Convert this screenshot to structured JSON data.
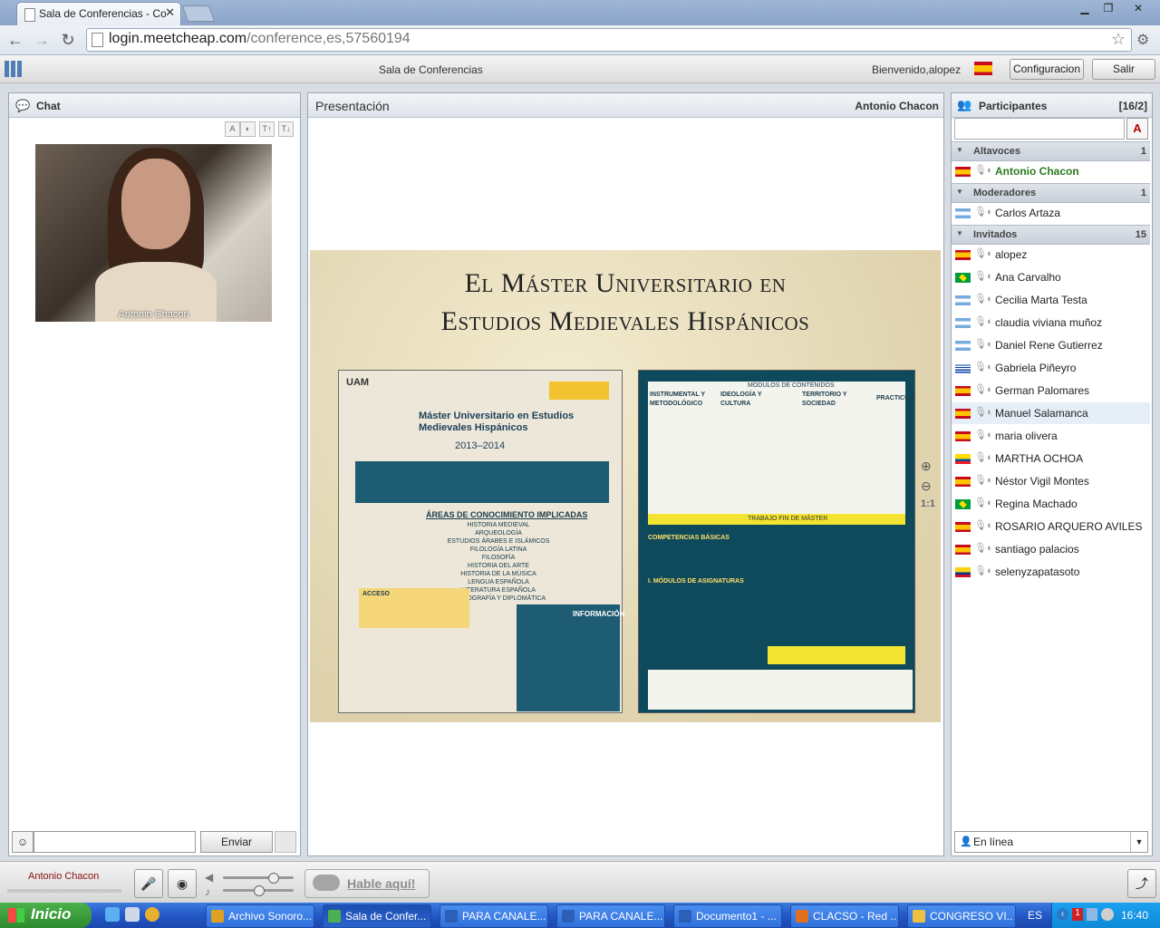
{
  "browser": {
    "tab_title": "Sala de Conferencias - Confe",
    "url_host": "login.meetcheap.com",
    "url_path": "/conference,es,57560194"
  },
  "app": {
    "room_title": "Sala de Conferencias",
    "welcome": "Bienvenido,alopez",
    "config_label": "Configuracion",
    "exit_label": "Salir"
  },
  "chat": {
    "title": "Chat",
    "video_caption": "Antonio Chacon",
    "send_label": "Enviar",
    "input_value": ""
  },
  "presentation": {
    "title": "Presentación",
    "presenter": "Antonio Chacon",
    "zoom_label": "1:1",
    "slide_title_line1": "El Máster Universitario en",
    "slide_title_line2": "Estudios Medievales Hispánicos",
    "left_page": {
      "univ": "UAM",
      "heading1": "Máster Universitario en Estudios",
      "heading2": "Medievales Hispánicos",
      "years": "2013–2014",
      "areas_title": "ÁREAS DE CONOCIMIENTO IMPLICADAS",
      "areas": [
        "HISTORIA MEDIEVAL",
        "ARQUEOLOGÍA",
        "ESTUDIOS ÁRABES E ISLÁMICOS",
        "FILOLOGÍA LATINA",
        "FILOSOFÍA",
        "HISTORIA DEL ARTE",
        "HISTORIA DE LA MÚSICA",
        "LENGUA ESPAÑOLA",
        "LITERATURA ESPAÑOLA",
        "PALEOGRAFÍA Y DIPLOMÁTICA"
      ],
      "info_title": "INFORMACIÓN",
      "acceso": "ACCESO"
    },
    "right_page": {
      "modules_title": "MÓDULOS DE CONTENIDOS",
      "col1": "INSTRUMENTAL Y METODOLÓGICO",
      "col2": "IDEOLOGÍA Y CULTURA",
      "col3": "TERRITORIO Y SOCIEDAD",
      "col4": "PRACTICUM",
      "tfm": "TRABAJO FIN DE MÁSTER",
      "competencias": "COMPETENCIAS BÁSICAS",
      "modulos": "I. MÓDULOS DE ASIGNATURAS"
    }
  },
  "participants": {
    "title": "Participantes",
    "count": "[16/2]",
    "sort_label": "A",
    "groups": [
      {
        "label": "Altavoces",
        "count": "1",
        "members": [
          {
            "name": "Antonio Chacon",
            "flag": "es",
            "speaker": true
          }
        ]
      },
      {
        "label": "Moderadores",
        "count": "1",
        "members": [
          {
            "name": "Carlos  Artaza",
            "flag": "ar"
          }
        ]
      },
      {
        "label": "Invitados",
        "count": "15",
        "members": [
          {
            "name": "alopez",
            "flag": "es"
          },
          {
            "name": "Ana Carvalho",
            "flag": "br"
          },
          {
            "name": "Cecilia Marta Testa",
            "flag": "ar"
          },
          {
            "name": "claudia viviana muñoz",
            "flag": "ar"
          },
          {
            "name": "Daniel Rene Gutierrez",
            "flag": "ar"
          },
          {
            "name": "Gabriela Piñeyro",
            "flag": "uy"
          },
          {
            "name": "German Palomares",
            "flag": "es"
          },
          {
            "name": "Manuel Salamanca",
            "flag": "es",
            "selected": true
          },
          {
            "name": "maria olivera",
            "flag": "es"
          },
          {
            "name": "MARTHA OCHOA",
            "flag": "ec"
          },
          {
            "name": "Néstor Vigil Montes",
            "flag": "es"
          },
          {
            "name": "Regina Machado",
            "flag": "br"
          },
          {
            "name": "ROSARIO ARQUERO AVILES",
            "flag": "es"
          },
          {
            "name": "santiago palacios",
            "flag": "es"
          },
          {
            "name": "selenyzapatasoto",
            "flag": "co"
          }
        ]
      }
    ],
    "status_value": "En línea"
  },
  "mediabar": {
    "speaker_name": "Antonio Chacon",
    "talk_label": "Hable aquí!"
  },
  "taskbar": {
    "start_label": "Inicio",
    "tasks": [
      {
        "label": "Archivo Sonoro...",
        "color": "#e0a020"
      },
      {
        "label": "Sala de Confer...",
        "color": "#4caf50",
        "active": true
      },
      {
        "label": "PARA CANALE...",
        "color": "#2b5fb8"
      },
      {
        "label": "PARA CANALE...",
        "color": "#2b5fb8"
      },
      {
        "label": "Documento1 - ...",
        "color": "#2b5fb8"
      },
      {
        "label": "CLACSO - Red ...",
        "color": "#e07020"
      },
      {
        "label": "CONGRESO VI...",
        "color": "#f0c040"
      }
    ],
    "lang": "ES",
    "clock": "16:40"
  }
}
